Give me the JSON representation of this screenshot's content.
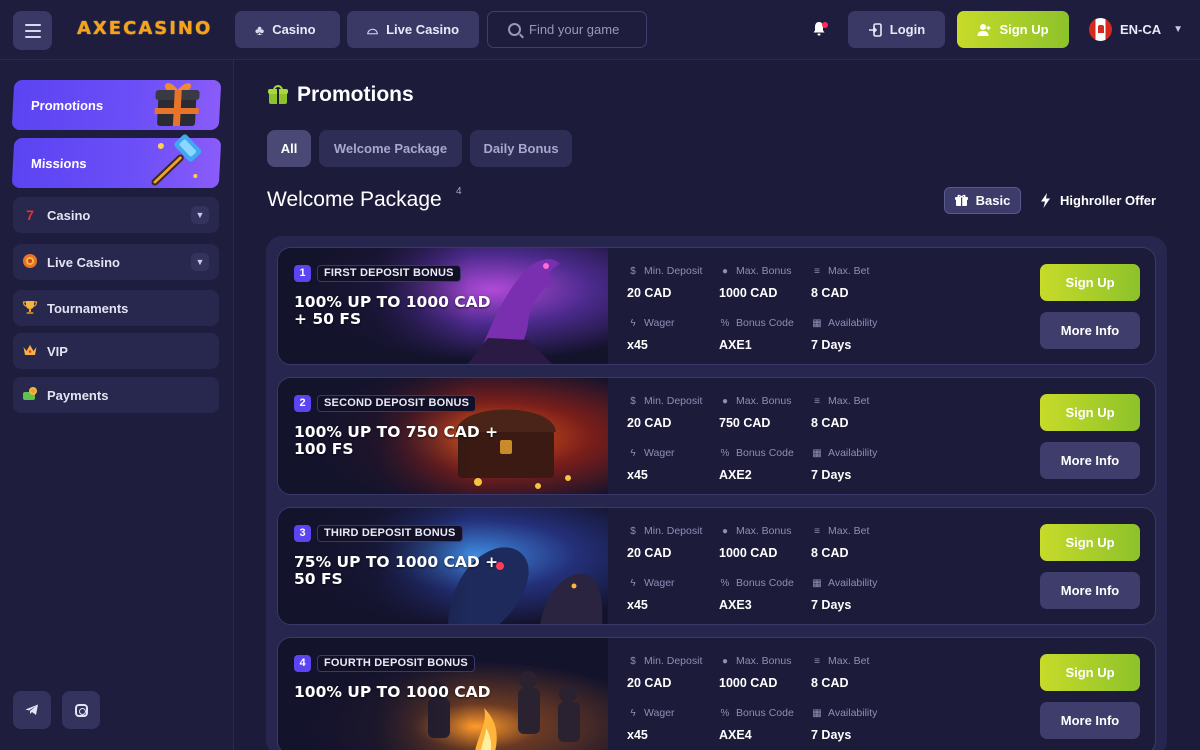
{
  "header": {
    "logo_text": "AXECASINO",
    "casino_label": "Casino",
    "live_casino_label": "Live Casino",
    "search_placeholder": "Find your game",
    "login_label": "Login",
    "signup_label": "Sign Up",
    "language": "EN-CA"
  },
  "sidebar": {
    "promotions_label": "Promotions",
    "missions_label": "Missions",
    "items": [
      {
        "label": "Casino",
        "icon": "seven-icon"
      },
      {
        "label": "Live Casino",
        "icon": "chip-icon"
      },
      {
        "label": "Tournaments",
        "icon": "trophy-icon"
      },
      {
        "label": "VIP",
        "icon": "crown-icon"
      },
      {
        "label": "Payments",
        "icon": "coins-icon"
      }
    ],
    "social": [
      "telegram-icon",
      "instagram-icon"
    ]
  },
  "main": {
    "title": "Promotions",
    "filters": [
      "All",
      "Welcome Package",
      "Daily Bonus"
    ],
    "section_title": "Welcome Package",
    "section_count": "4",
    "toggle_basic": "Basic",
    "toggle_highroller": "Highroller Offer",
    "stat_labels": {
      "min_deposit": "Min. Deposit",
      "max_bonus": "Max. Bonus",
      "max_bet": "Max. Bet",
      "wager": "Wager",
      "bonus_code": "Bonus Code",
      "availability": "Availability"
    },
    "signup_label": "Sign Up",
    "more_info_label": "More Info",
    "promos": [
      {
        "num": "1",
        "badge": "FIRST DEPOSIT BONUS",
        "headline": "100% UP TO 1000 CAD + 50 FS",
        "min_deposit": "20 CAD",
        "max_bonus": "1000 CAD",
        "max_bet": "8 CAD",
        "wager": "x45",
        "bonus_code": "AXE1",
        "availability": "7 Days"
      },
      {
        "num": "2",
        "badge": "SECOND DEPOSIT BONUS",
        "headline": "100% UP TO 750 CAD + 100 FS",
        "min_deposit": "20 CAD",
        "max_bonus": "750 CAD",
        "max_bet": "8 CAD",
        "wager": "x45",
        "bonus_code": "AXE2",
        "availability": "7 Days"
      },
      {
        "num": "3",
        "badge": "THIRD DEPOSIT BONUS",
        "headline": "75% UP TO 1000 CAD + 50 FS",
        "min_deposit": "20 CAD",
        "max_bonus": "1000 CAD",
        "max_bet": "8 CAD",
        "wager": "x45",
        "bonus_code": "AXE3",
        "availability": "7 Days"
      },
      {
        "num": "4",
        "badge": "FOURTH DEPOSIT BONUS",
        "headline": "100% UP TO 1000 CAD",
        "min_deposit": "20 CAD",
        "max_bonus": "1000 CAD",
        "max_bet": "8 CAD",
        "wager": "x45",
        "bonus_code": "AXE4",
        "availability": "7 Days"
      }
    ]
  },
  "colors": {
    "background": "#1c1b3a",
    "accent_green": "#8dc22a",
    "accent_purple": "#5b44f2",
    "logo_orange": "#f7a21b"
  }
}
